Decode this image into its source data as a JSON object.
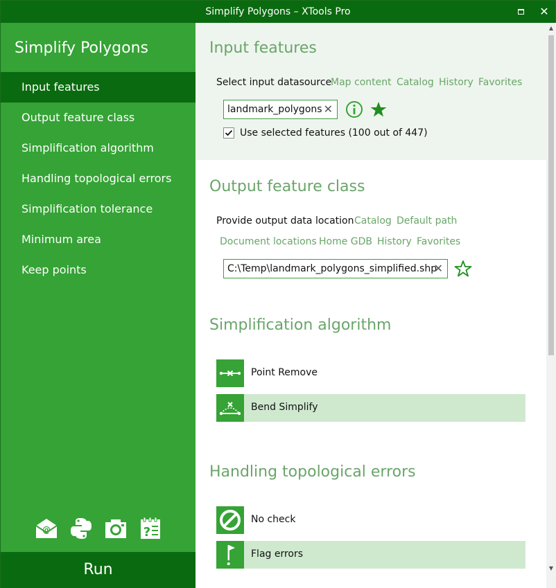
{
  "window": {
    "title": "Simplify Polygons – XTools Pro"
  },
  "sidebar": {
    "app_title": "Simplify Polygons",
    "items": [
      {
        "label": "Input features",
        "active": true
      },
      {
        "label": "Output feature class"
      },
      {
        "label": "Simplification algorithm"
      },
      {
        "label": "Handling topological errors"
      },
      {
        "label": "Simplification tolerance"
      },
      {
        "label": "Minimum area"
      },
      {
        "label": "Keep points"
      }
    ],
    "tools": [
      "email-icon",
      "python-icon",
      "camera-icon",
      "help-icon"
    ],
    "run_label": "Run"
  },
  "input": {
    "title": "Input features",
    "prompt": "Select input datasource",
    "links": [
      "Map content",
      "Catalog",
      "History",
      "Favorites"
    ],
    "value": "landmark_polygons",
    "use_selected_label": "Use selected features (100 out of 447)",
    "use_selected_checked": true
  },
  "output": {
    "title": "Output feature class",
    "prompt": "Provide output data location",
    "links_row1": [
      "Catalog",
      "Default path"
    ],
    "links_row2": [
      "Document locations",
      "Home GDB",
      "History",
      "Favorites"
    ],
    "value": "C:\\Temp\\landmark_polygons_simplified.shp"
  },
  "algorithm": {
    "title": "Simplification algorithm",
    "options": [
      {
        "label": "Point  Remove",
        "icon": "point-remove-icon",
        "selected": false
      },
      {
        "label": "Bend Simplify",
        "icon": "bend-simplify-icon",
        "selected": true
      }
    ]
  },
  "topology": {
    "title": "Handling topological errors",
    "options": [
      {
        "label": "No check",
        "icon": "no-check-icon",
        "selected": false
      },
      {
        "label": "Flag errors",
        "icon": "flag-icon",
        "selected": true
      }
    ]
  },
  "colors": {
    "title_bar": "#0a6a0f",
    "sidebar": "#35a335",
    "accent_text": "#6aa56a",
    "selected_option": "#cfe9cf"
  }
}
